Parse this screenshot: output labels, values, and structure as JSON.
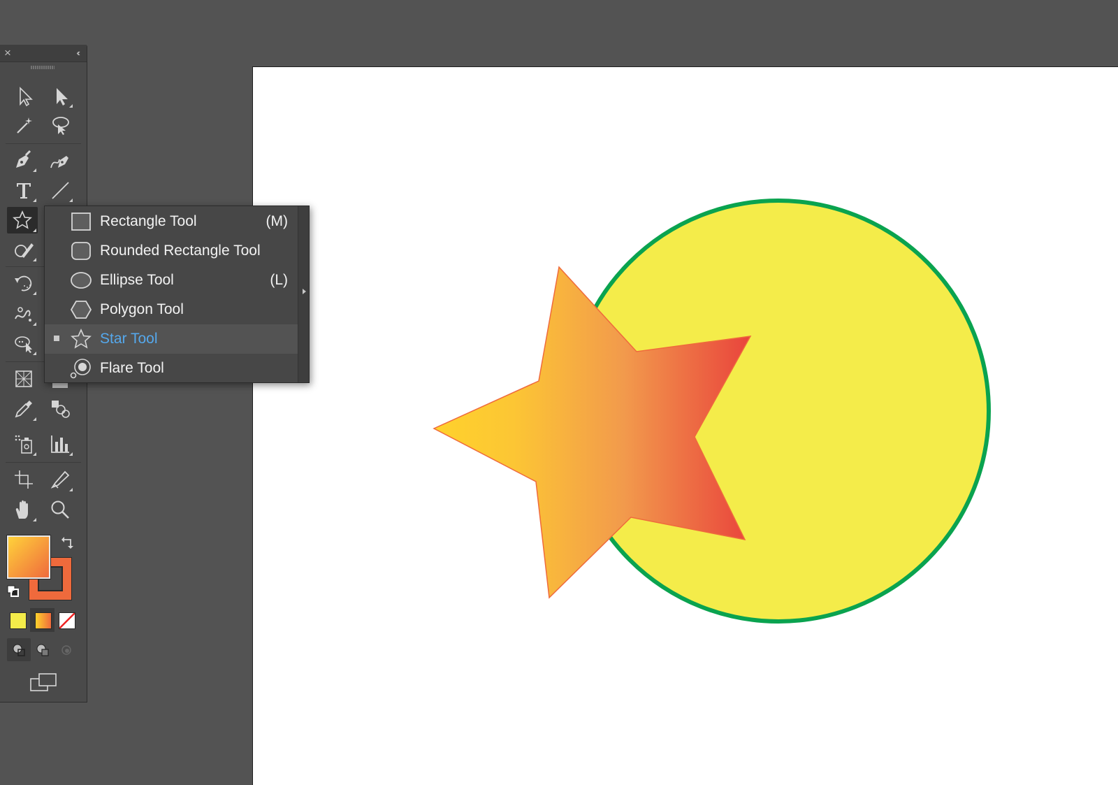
{
  "flyout": {
    "items": [
      {
        "label": "Rectangle Tool",
        "shortcut": "(M)",
        "icon": "rectangle-icon"
      },
      {
        "label": "Rounded Rectangle Tool",
        "shortcut": "",
        "icon": "rounded-rectangle-icon"
      },
      {
        "label": "Ellipse Tool",
        "shortcut": "(L)",
        "icon": "ellipse-icon"
      },
      {
        "label": "Polygon Tool",
        "shortcut": "",
        "icon": "polygon-icon"
      },
      {
        "label": "Star Tool",
        "shortcut": "",
        "icon": "star-icon",
        "selected": true
      },
      {
        "label": "Flare Tool",
        "shortcut": "",
        "icon": "flare-icon"
      }
    ]
  },
  "tools_panel": {
    "close_glyph": "×",
    "collapse_glyph": "‹‹",
    "active_tool": "star-tool"
  },
  "colors": {
    "workspace": "#535353",
    "panel": "#4a4a4a",
    "selected_label": "#55a8ec",
    "circle_fill": "#f4ec4a",
    "circle_stroke": "#0aa34f",
    "star_gradient_start": "#ffcd2f",
    "star_gradient_end": "#ea4a3c",
    "star_stroke": "#ef6a3c"
  }
}
